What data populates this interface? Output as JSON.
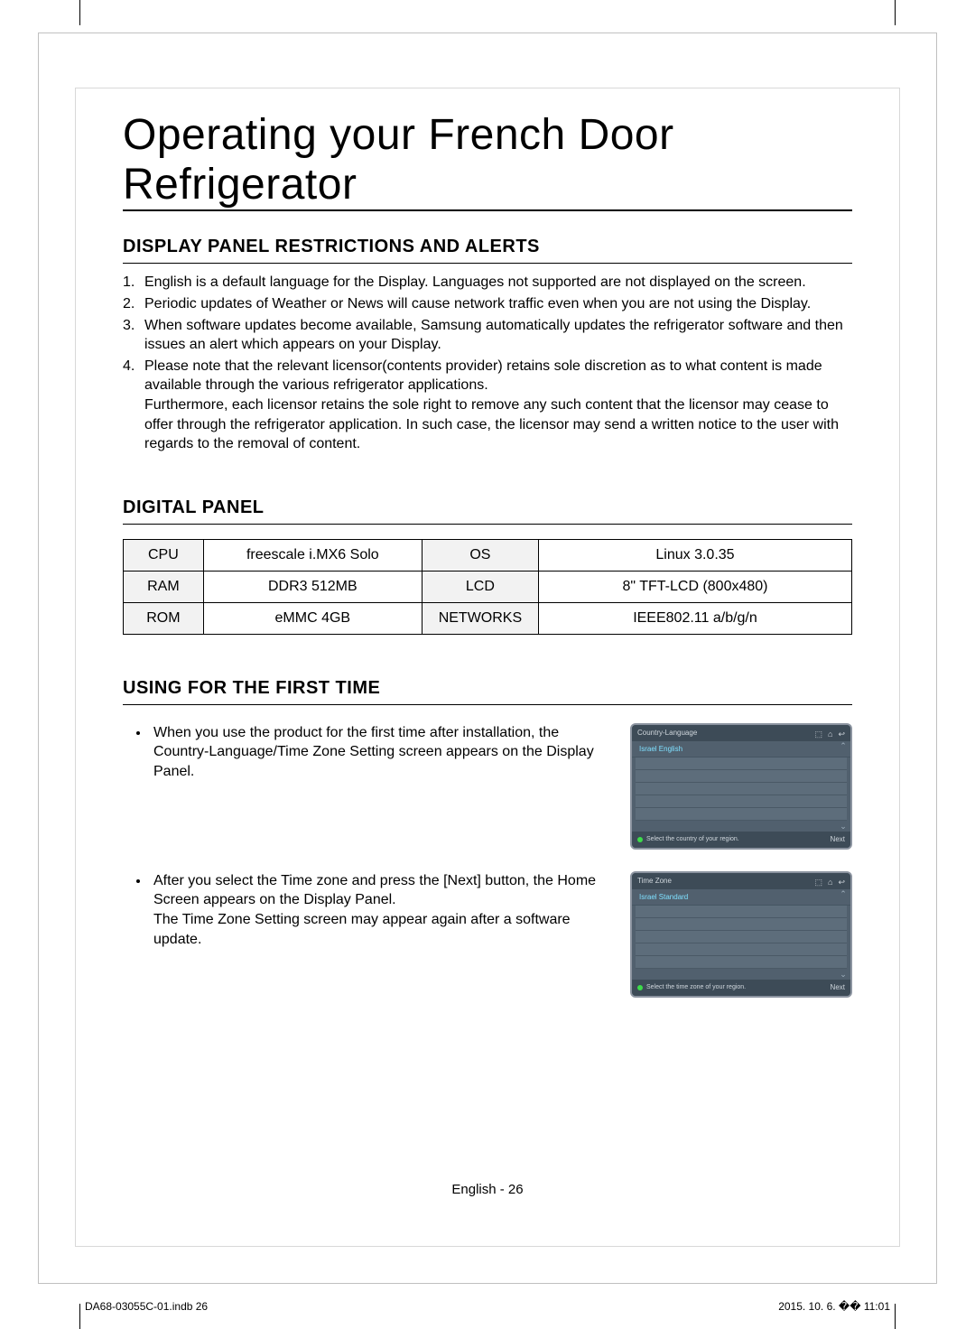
{
  "chapter_title": "Operating your French Door Refrigerator",
  "section1": {
    "heading": "DISPLAY PANEL RESTRICTIONS AND ALERTS",
    "items": [
      "English is a default language for the Display. Languages not supported are not displayed on the screen.",
      "Periodic updates of Weather or News will cause network traffic even when you are not using the Display.",
      "When software updates become available, Samsung automatically updates the refrigerator software and then issues an alert which appears on your Display.",
      "Please note that the relevant licensor(contents provider) retains sole discretion as to what content is made available through the various refrigerator applications.\nFurthermore, each licensor retains the sole right to remove any such content that the licensor may cease to offer through the refrigerator application. In such case, the licensor may send a written notice to the user with regards to the removal of content."
    ]
  },
  "section2": {
    "heading": "DIGITAL PANEL",
    "table": {
      "rows": [
        {
          "l1": "CPU",
          "v1": "freescale i.MX6 Solo",
          "l2": "OS",
          "v2": "Linux 3.0.35"
        },
        {
          "l1": "RAM",
          "v1": "DDR3 512MB",
          "l2": "LCD",
          "v2": "8\" TFT-LCD (800x480)"
        },
        {
          "l1": "ROM",
          "v1": "eMMC 4GB",
          "l2": "NETWORKS",
          "v2": "IEEE802.11 a/b/g/n"
        }
      ]
    }
  },
  "section3": {
    "heading": "USING FOR THE FIRST TIME",
    "bullets": [
      "When you use the product for the first time after installation, the Country-Language/Time Zone Setting screen appears on the Display Panel.",
      "After you select the Time zone and press the [Next] button, the Home Screen appears on the Display Panel.\nThe Time Zone Setting screen may appear again after a software update."
    ],
    "panel1": {
      "title": "Country-Language",
      "selected": "Israel  English",
      "footer": "Select the country of your region.",
      "next": "Next"
    },
    "panel2": {
      "title": "Time Zone",
      "selected": "Israel Standard",
      "footer": "Select the time zone of your region.",
      "next": "Next"
    }
  },
  "footer": {
    "center": "English - 26",
    "left": "DA68-03055C-01.indb   26",
    "right": "2015. 10. 6.   �� 11:01"
  }
}
